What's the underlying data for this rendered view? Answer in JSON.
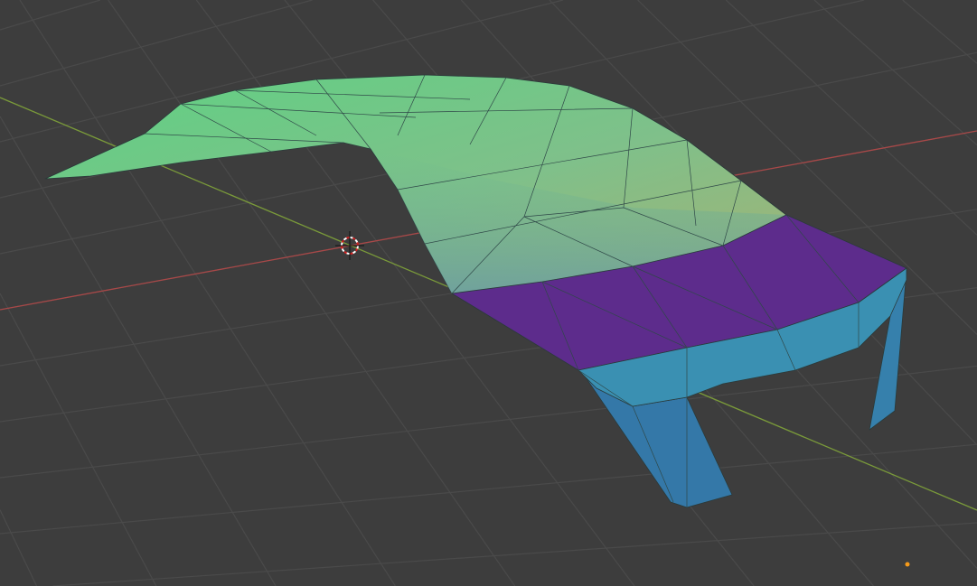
{
  "viewport": {
    "type": "3d-viewport",
    "background_color": "#3d3d3d",
    "grid_color": "#4a4a4a",
    "x_axis_color": "#a84848",
    "y_axis_color": "#7a9a3a"
  },
  "mesh": {
    "roof_color_start": "#5fd183",
    "roof_color_end": "#a4b274",
    "roof_color_bottom": "#6c9fa0",
    "band_color": "#5d2c8c",
    "front_color": "#3a90b2",
    "legs_color": "#3478a8",
    "edge_color": "#2a3a3a"
  },
  "icons": [
    "3d-cursor-icon",
    "origin-dot-icon"
  ],
  "origin_color": "#f59a1a"
}
